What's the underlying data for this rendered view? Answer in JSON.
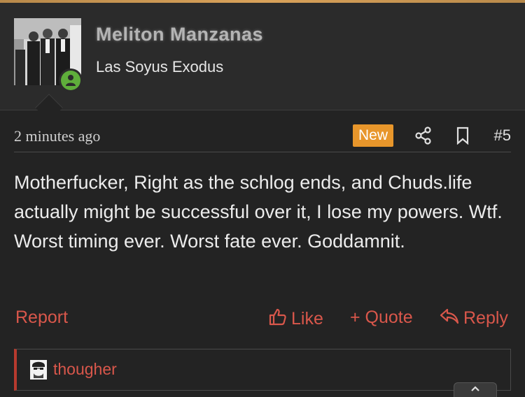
{
  "colors": {
    "background": "#232323",
    "header_background": "#2b2b2b",
    "accent": "#d9a25a",
    "action_red": "#d9574b",
    "badge_orange": "#e8962b",
    "online_green": "#5fae3b"
  },
  "author": {
    "username": "Meliton Manzanas",
    "title": "Las Soyus Exodus",
    "online_icon": "user-online-icon",
    "avatar_image": "black-and-white-photo-of-men-in-suits"
  },
  "post": {
    "timestamp": "2 minutes ago",
    "new_badge": "New",
    "share_icon": "share-icon",
    "bookmark_icon": "bookmark-icon",
    "number": "#5",
    "body": "Motherfucker, Right as the schlog ends, and Chuds.life actually might be successful over it, I lose my powers. Wtf. Worst timing ever. Worst fate ever. Goddamnit."
  },
  "actions": {
    "report": "Report",
    "like": "Like",
    "quote": "+ Quote",
    "reply": "Reply"
  },
  "reactions": {
    "user": "thougher"
  }
}
